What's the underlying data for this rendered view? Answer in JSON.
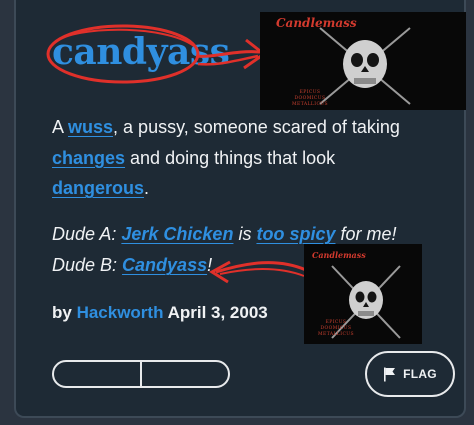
{
  "entry": {
    "word": "candyass",
    "definition": {
      "part1": "A ",
      "link1": "wuss",
      "part2": ", a pussy, someone scared of taking ",
      "link2": "changes",
      "part3": " and doing things that look ",
      "link3": "dangerous",
      "part4": "."
    },
    "example": {
      "line1_prefix": "Dude A: ",
      "link1": "Jerk Chicken",
      "mid1": " is ",
      "link2": "too spicy",
      "line1_suffix": " for me!",
      "line2_prefix": "Dude B: ",
      "link3": "Candyass",
      "line2_suffix": "!"
    },
    "byline": {
      "prefix": "by ",
      "author": "Hackworth",
      "date": " April 3, 2003"
    }
  },
  "album_art": {
    "band": "Candlemass",
    "title_lines": [
      "EPICUS",
      "DOOMICUS",
      "METALLICUS"
    ]
  },
  "actions": {
    "flag_label": "FLAG",
    "flag_icon": "flag-icon"
  },
  "colors": {
    "link": "#2f8fe0",
    "annotation": "#e0302a",
    "card_bg": "#1e2a35"
  }
}
